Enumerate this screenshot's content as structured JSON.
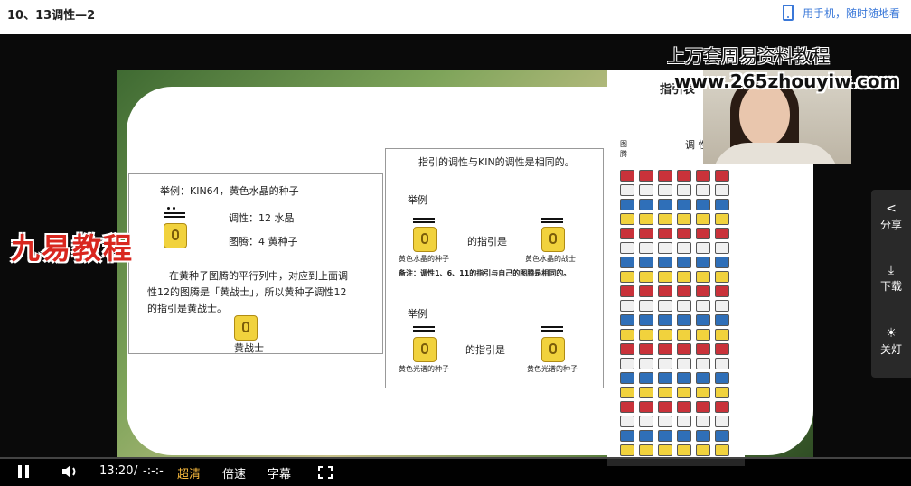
{
  "header": {
    "title": "10、13调性—2",
    "mobile_link": "用手机，随时随地看"
  },
  "watermarks": {
    "top": "上万套周易资料教程",
    "url": "www.265zhouyiw.com",
    "brand": "九易教程"
  },
  "slide": {
    "left_box": {
      "example_line": "举例：KIN64，黄色水晶的种子",
      "tone_line": "调性：12 水晶",
      "totem_line": "图腾：4  黄种子",
      "para_1": "在黄种子图腾的平行列中，对应到上面调",
      "para_2": "性12的图腾是「黄战士」，所以黄种子调性12",
      "para_3": "的指引是黄战士。",
      "glyph_caption": "黄战士"
    },
    "right_box": {
      "heading": "指引的调性与KIN的调性是相同的。",
      "example_1": "举例",
      "pair_1_left": "黄色水晶的种子",
      "pair_1_mid": "的指引是",
      "pair_1_right": "黄色水晶的战士",
      "note": "备注：调性1、6、11的指引与自己的图腾是相同的。",
      "example_2": "举例",
      "pair_2_left": "黄色光谱的种子",
      "pair_2_mid": "的指引是",
      "pair_2_right": "黄色光谱的种子"
    },
    "grid_panel": {
      "title": "指引表",
      "col_totem": "图腾",
      "col_tone": "调  性"
    }
  },
  "side_toolbar": {
    "share": "分享",
    "download": "下载",
    "lights": "关灯"
  },
  "controls": {
    "time": "13:20",
    "separator": "/",
    "duration": "-:-:-",
    "quality": "超清",
    "speed": "倍速",
    "subtitles": "字幕"
  },
  "colors": {
    "accent_link": "#3a78d8",
    "quality_active": "#f5b83d",
    "glyph_red": "#c9323a",
    "glyph_white": "#f0f0f0",
    "glyph_blue": "#2f6fb8",
    "glyph_yellow": "#f1d23d"
  },
  "icons": {
    "phone": "phone-icon",
    "share": "share-icon",
    "download": "download-icon",
    "lights": "lightbulb-icon",
    "play_pause": "pause-icon",
    "volume": "volume-icon",
    "fullscreen": "fullscreen-icon"
  }
}
